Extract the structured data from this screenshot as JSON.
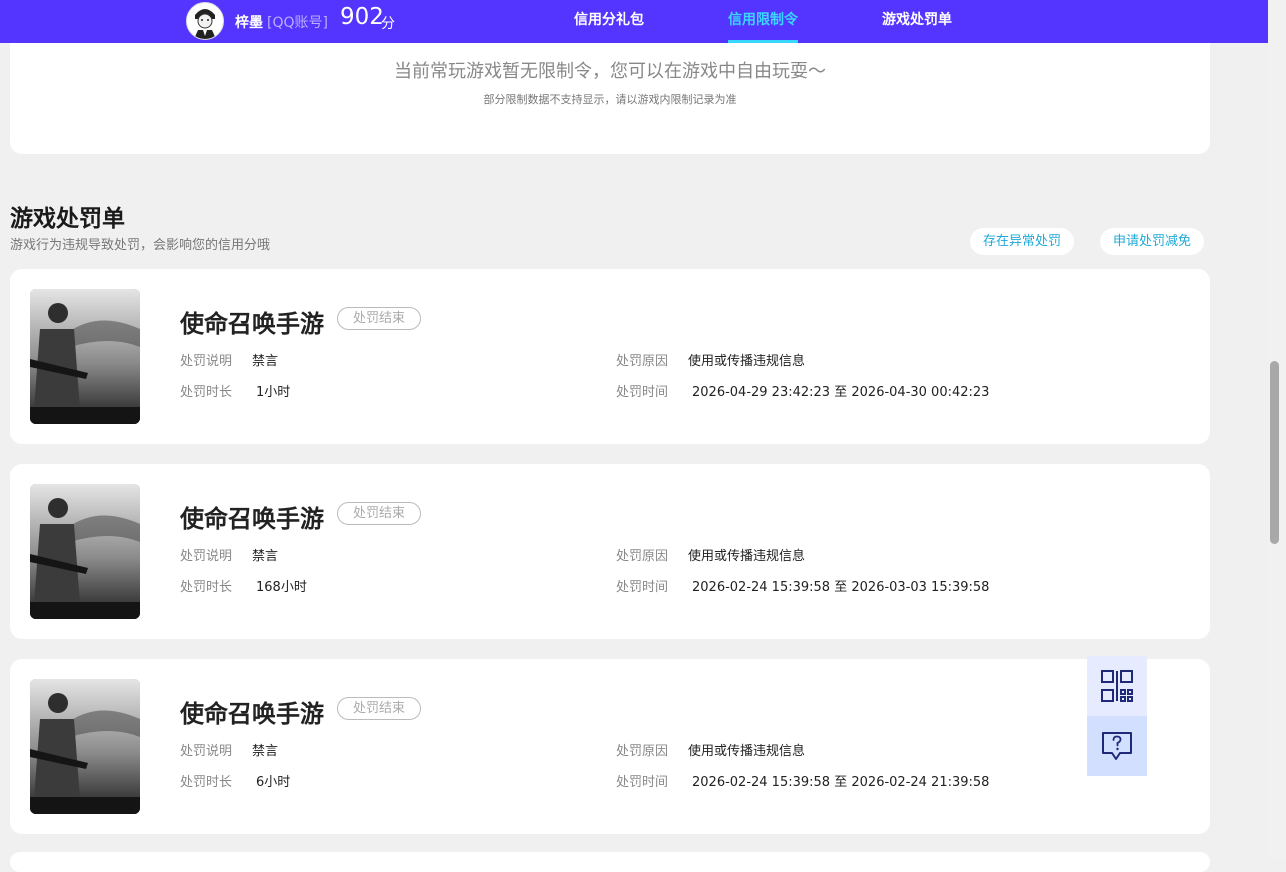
{
  "header": {
    "user_name": "梓墨",
    "account_type": "[QQ账号]",
    "score": "902",
    "score_unit": "分",
    "tabs": [
      {
        "label": "信用分礼包",
        "active": false
      },
      {
        "label": "信用限制令",
        "active": true
      },
      {
        "label": "游戏处罚单",
        "active": false
      }
    ]
  },
  "restriction": {
    "message": "当前常玩游戏暂无限制令，您可以在游戏中自由玩耍～",
    "note": "部分限制数据不支持显示，请以游戏内限制记录为准"
  },
  "penalties": {
    "title": "游戏处罚单",
    "subtitle": "游戏行为违规导致处罚，会影响您的信用分哦",
    "btn_abnormal": "存在异常处罚",
    "btn_appeal": "申请处罚减免",
    "labels": {
      "desc": "处罚说明",
      "reason": "处罚原因",
      "duration": "处罚时长",
      "time": "处罚时间",
      "to": "至"
    },
    "items": [
      {
        "game": "使命召唤手游",
        "status": "处罚结束",
        "desc": "禁言",
        "reason": "使用或传播违规信息",
        "duration": "1小时",
        "start": "2026-04-29 23:42:23",
        "end": "2026-04-30 00:42:23"
      },
      {
        "game": "使命召唤手游",
        "status": "处罚结束",
        "desc": "禁言",
        "reason": "使用或传播违规信息",
        "duration": "168小时",
        "start": "2026-02-24 15:39:58",
        "end": "2026-03-03 15:39:58"
      },
      {
        "game": "使命召唤手游",
        "status": "处罚结束",
        "desc": "禁言",
        "reason": "使用或传播违规信息",
        "duration": "6小时",
        "start": "2026-02-24 15:39:58",
        "end": "2026-02-24 21:39:58"
      }
    ]
  },
  "float_tools": {
    "qr_icon": "qr-code-icon",
    "help_icon": "help-chat-icon"
  },
  "colors": {
    "nav_bg": "#5434ff",
    "nav_active": "#39d6ff",
    "link": "#1ea9d6"
  }
}
